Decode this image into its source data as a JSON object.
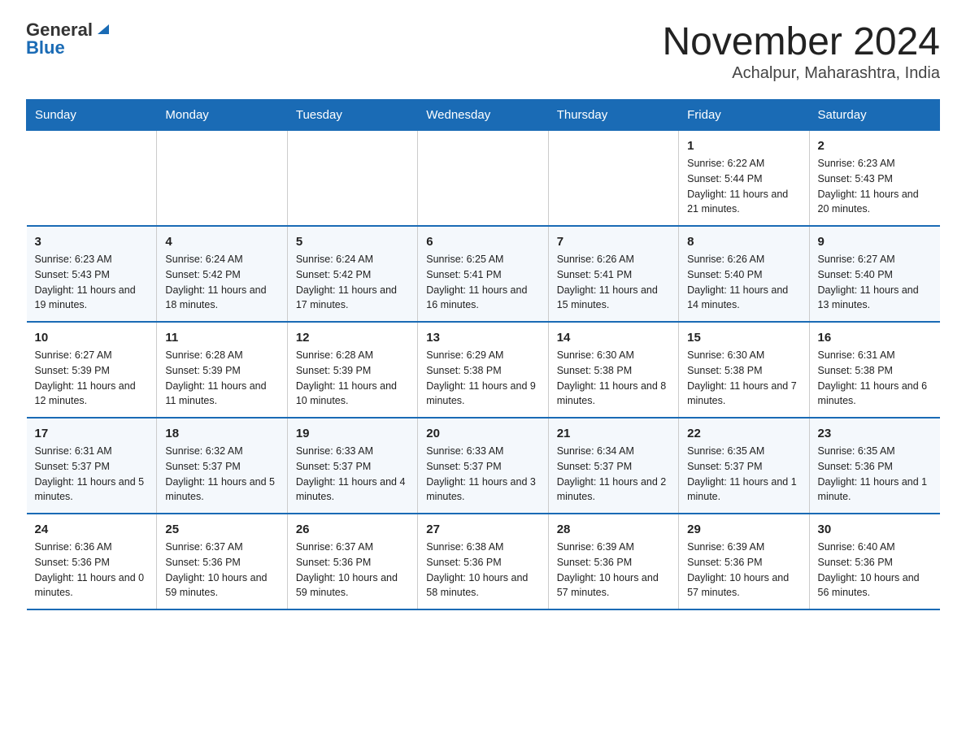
{
  "header": {
    "logo_general": "General",
    "logo_blue": "Blue",
    "month_title": "November 2024",
    "location": "Achalpur, Maharashtra, India"
  },
  "weekdays": [
    "Sunday",
    "Monday",
    "Tuesday",
    "Wednesday",
    "Thursday",
    "Friday",
    "Saturday"
  ],
  "weeks": [
    [
      {
        "day": "",
        "info": ""
      },
      {
        "day": "",
        "info": ""
      },
      {
        "day": "",
        "info": ""
      },
      {
        "day": "",
        "info": ""
      },
      {
        "day": "",
        "info": ""
      },
      {
        "day": "1",
        "info": "Sunrise: 6:22 AM\nSunset: 5:44 PM\nDaylight: 11 hours and 21 minutes."
      },
      {
        "day": "2",
        "info": "Sunrise: 6:23 AM\nSunset: 5:43 PM\nDaylight: 11 hours and 20 minutes."
      }
    ],
    [
      {
        "day": "3",
        "info": "Sunrise: 6:23 AM\nSunset: 5:43 PM\nDaylight: 11 hours and 19 minutes."
      },
      {
        "day": "4",
        "info": "Sunrise: 6:24 AM\nSunset: 5:42 PM\nDaylight: 11 hours and 18 minutes."
      },
      {
        "day": "5",
        "info": "Sunrise: 6:24 AM\nSunset: 5:42 PM\nDaylight: 11 hours and 17 minutes."
      },
      {
        "day": "6",
        "info": "Sunrise: 6:25 AM\nSunset: 5:41 PM\nDaylight: 11 hours and 16 minutes."
      },
      {
        "day": "7",
        "info": "Sunrise: 6:26 AM\nSunset: 5:41 PM\nDaylight: 11 hours and 15 minutes."
      },
      {
        "day": "8",
        "info": "Sunrise: 6:26 AM\nSunset: 5:40 PM\nDaylight: 11 hours and 14 minutes."
      },
      {
        "day": "9",
        "info": "Sunrise: 6:27 AM\nSunset: 5:40 PM\nDaylight: 11 hours and 13 minutes."
      }
    ],
    [
      {
        "day": "10",
        "info": "Sunrise: 6:27 AM\nSunset: 5:39 PM\nDaylight: 11 hours and 12 minutes."
      },
      {
        "day": "11",
        "info": "Sunrise: 6:28 AM\nSunset: 5:39 PM\nDaylight: 11 hours and 11 minutes."
      },
      {
        "day": "12",
        "info": "Sunrise: 6:28 AM\nSunset: 5:39 PM\nDaylight: 11 hours and 10 minutes."
      },
      {
        "day": "13",
        "info": "Sunrise: 6:29 AM\nSunset: 5:38 PM\nDaylight: 11 hours and 9 minutes."
      },
      {
        "day": "14",
        "info": "Sunrise: 6:30 AM\nSunset: 5:38 PM\nDaylight: 11 hours and 8 minutes."
      },
      {
        "day": "15",
        "info": "Sunrise: 6:30 AM\nSunset: 5:38 PM\nDaylight: 11 hours and 7 minutes."
      },
      {
        "day": "16",
        "info": "Sunrise: 6:31 AM\nSunset: 5:38 PM\nDaylight: 11 hours and 6 minutes."
      }
    ],
    [
      {
        "day": "17",
        "info": "Sunrise: 6:31 AM\nSunset: 5:37 PM\nDaylight: 11 hours and 5 minutes."
      },
      {
        "day": "18",
        "info": "Sunrise: 6:32 AM\nSunset: 5:37 PM\nDaylight: 11 hours and 5 minutes."
      },
      {
        "day": "19",
        "info": "Sunrise: 6:33 AM\nSunset: 5:37 PM\nDaylight: 11 hours and 4 minutes."
      },
      {
        "day": "20",
        "info": "Sunrise: 6:33 AM\nSunset: 5:37 PM\nDaylight: 11 hours and 3 minutes."
      },
      {
        "day": "21",
        "info": "Sunrise: 6:34 AM\nSunset: 5:37 PM\nDaylight: 11 hours and 2 minutes."
      },
      {
        "day": "22",
        "info": "Sunrise: 6:35 AM\nSunset: 5:37 PM\nDaylight: 11 hours and 1 minute."
      },
      {
        "day": "23",
        "info": "Sunrise: 6:35 AM\nSunset: 5:36 PM\nDaylight: 11 hours and 1 minute."
      }
    ],
    [
      {
        "day": "24",
        "info": "Sunrise: 6:36 AM\nSunset: 5:36 PM\nDaylight: 11 hours and 0 minutes."
      },
      {
        "day": "25",
        "info": "Sunrise: 6:37 AM\nSunset: 5:36 PM\nDaylight: 10 hours and 59 minutes."
      },
      {
        "day": "26",
        "info": "Sunrise: 6:37 AM\nSunset: 5:36 PM\nDaylight: 10 hours and 59 minutes."
      },
      {
        "day": "27",
        "info": "Sunrise: 6:38 AM\nSunset: 5:36 PM\nDaylight: 10 hours and 58 minutes."
      },
      {
        "day": "28",
        "info": "Sunrise: 6:39 AM\nSunset: 5:36 PM\nDaylight: 10 hours and 57 minutes."
      },
      {
        "day": "29",
        "info": "Sunrise: 6:39 AM\nSunset: 5:36 PM\nDaylight: 10 hours and 57 minutes."
      },
      {
        "day": "30",
        "info": "Sunrise: 6:40 AM\nSunset: 5:36 PM\nDaylight: 10 hours and 56 minutes."
      }
    ]
  ]
}
